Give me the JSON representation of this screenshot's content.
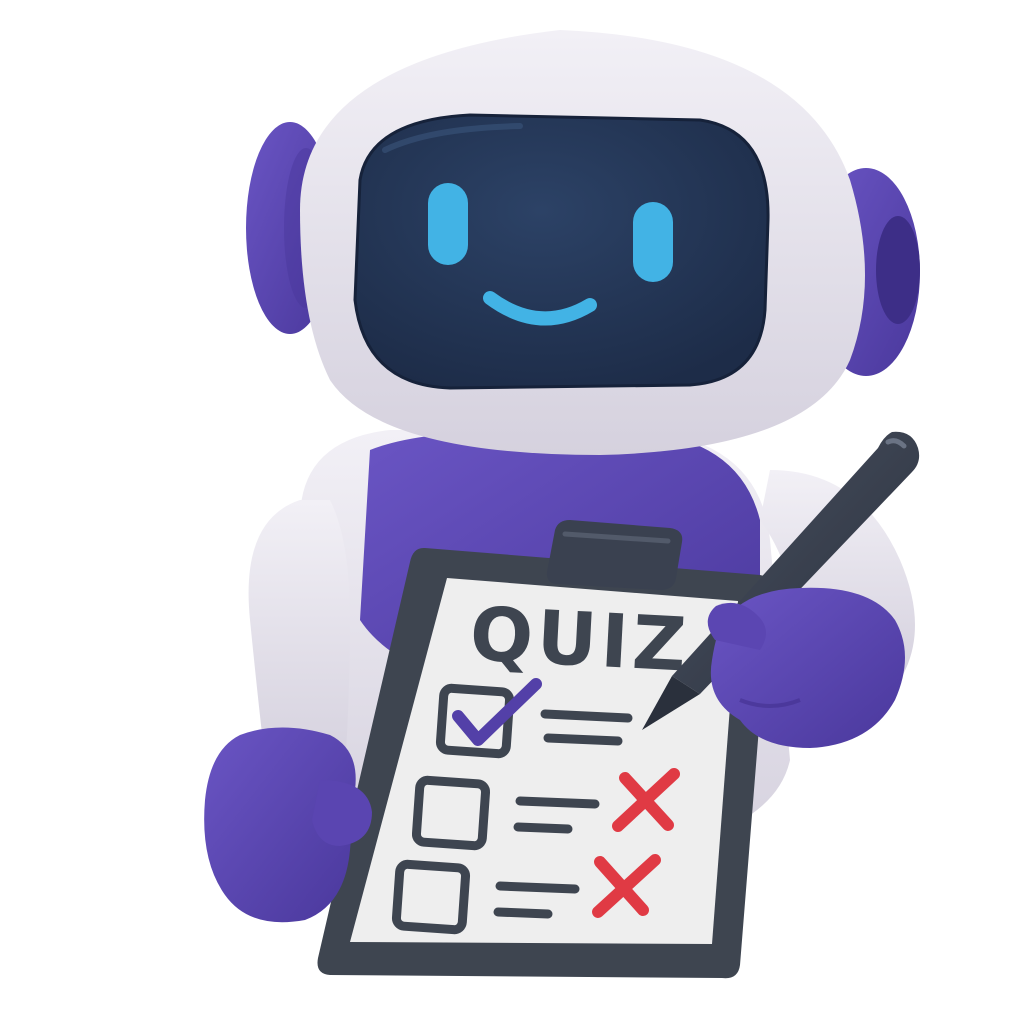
{
  "clipboard": {
    "title": "QUIZ"
  },
  "quiz_items": [
    {
      "state": "checked",
      "mark": "checkmark-icon"
    },
    {
      "state": "wrong",
      "mark": "cross-icon"
    },
    {
      "state": "wrong",
      "mark": "cross-icon"
    }
  ],
  "colors": {
    "robot_white": "#e3e0ea",
    "robot_purple": "#5b46b2",
    "visor_dark": "#243655",
    "face_cyan": "#42b3e5",
    "clipboard_frame": "#3e4550",
    "paper": "#eeeeee",
    "cross_red": "#e03a44",
    "check_purple": "#5340a8",
    "pen_dark": "#323a48"
  }
}
